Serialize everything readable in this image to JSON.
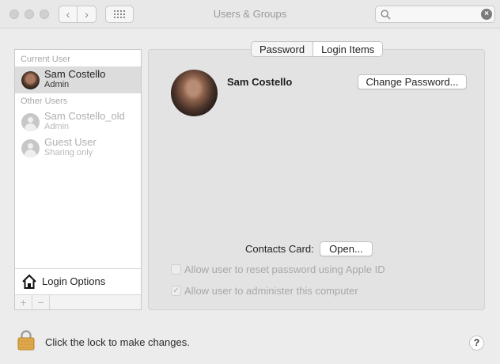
{
  "window": {
    "title": "Users & Groups",
    "search_placeholder": "",
    "back_glyph": "‹",
    "forward_glyph": "›",
    "clear_glyph": "×"
  },
  "tabs": [
    {
      "label": "Password",
      "active": false
    },
    {
      "label": "Login Items",
      "active": true
    }
  ],
  "sidebar": {
    "current_user_header": "Current User",
    "other_users_header": "Other Users",
    "current_user": {
      "name": "Sam Costello",
      "role": "Admin"
    },
    "other_users": [
      {
        "name": "Sam Costello_old",
        "role": "Admin"
      },
      {
        "name": "Guest User",
        "role": "Sharing only"
      }
    ],
    "login_options_label": "Login Options",
    "add_glyph": "+",
    "remove_glyph": "−"
  },
  "account": {
    "name": "Sam Costello",
    "change_password_label": "Change Password...",
    "contacts_card_label": "Contacts Card:",
    "open_button_label": "Open...",
    "options": [
      {
        "label": "Allow user to reset password using Apple ID",
        "checked": false
      },
      {
        "label": "Allow user to administer this computer",
        "checked": true
      }
    ],
    "check_glyph": "✓"
  },
  "footer": {
    "lock_text": "Click the lock to make changes.",
    "help_glyph": "?"
  },
  "icons": {
    "lock": "lock-icon",
    "home": "house-icon",
    "search": "search-icon",
    "help": "help-icon"
  },
  "colors": {
    "window_bg": "#ececec",
    "panel_bg": "#e3e3e3",
    "selection": "#dcdcdc",
    "lock": "#e0a94c"
  }
}
